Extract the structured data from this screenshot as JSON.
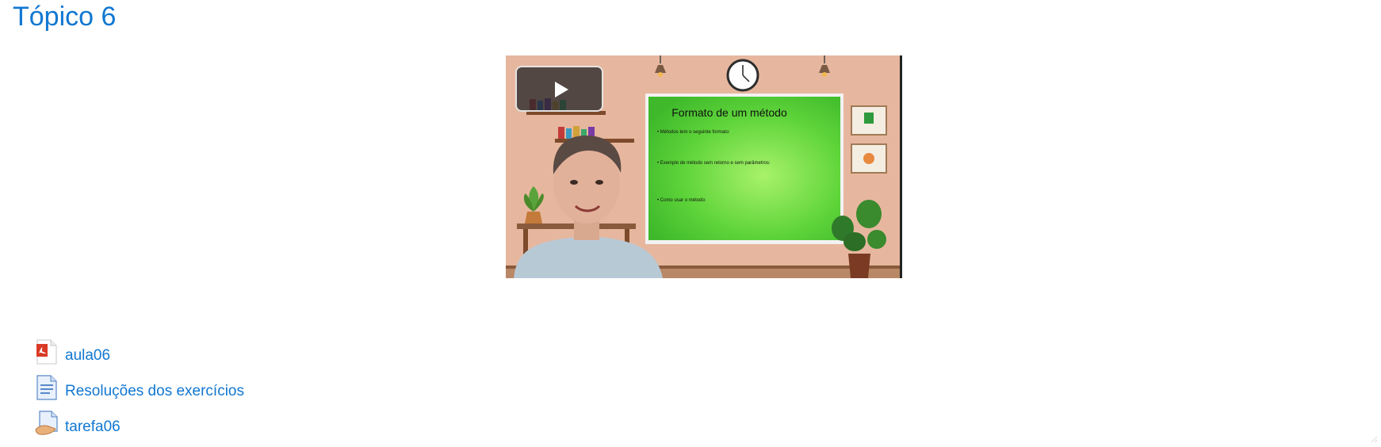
{
  "topic": {
    "title": "Tópico 6"
  },
  "video": {
    "slide_title": "Formato de um método",
    "slide_bullets": [
      "• Métodos tem o seguinte formato:",
      "• Exemplo de método sem retorno e sem parâmetros:",
      "• Como usar o método:"
    ]
  },
  "activities": [
    {
      "label": "aula06",
      "icon": "pdf-icon"
    },
    {
      "label": "Resoluções dos exercícios",
      "icon": "page-icon"
    },
    {
      "label": "tarefa06",
      "icon": "assignment-icon"
    }
  ],
  "colors": {
    "link": "#1177d1",
    "slide_green": "#52c43a",
    "wall": "#e8b9a0"
  }
}
